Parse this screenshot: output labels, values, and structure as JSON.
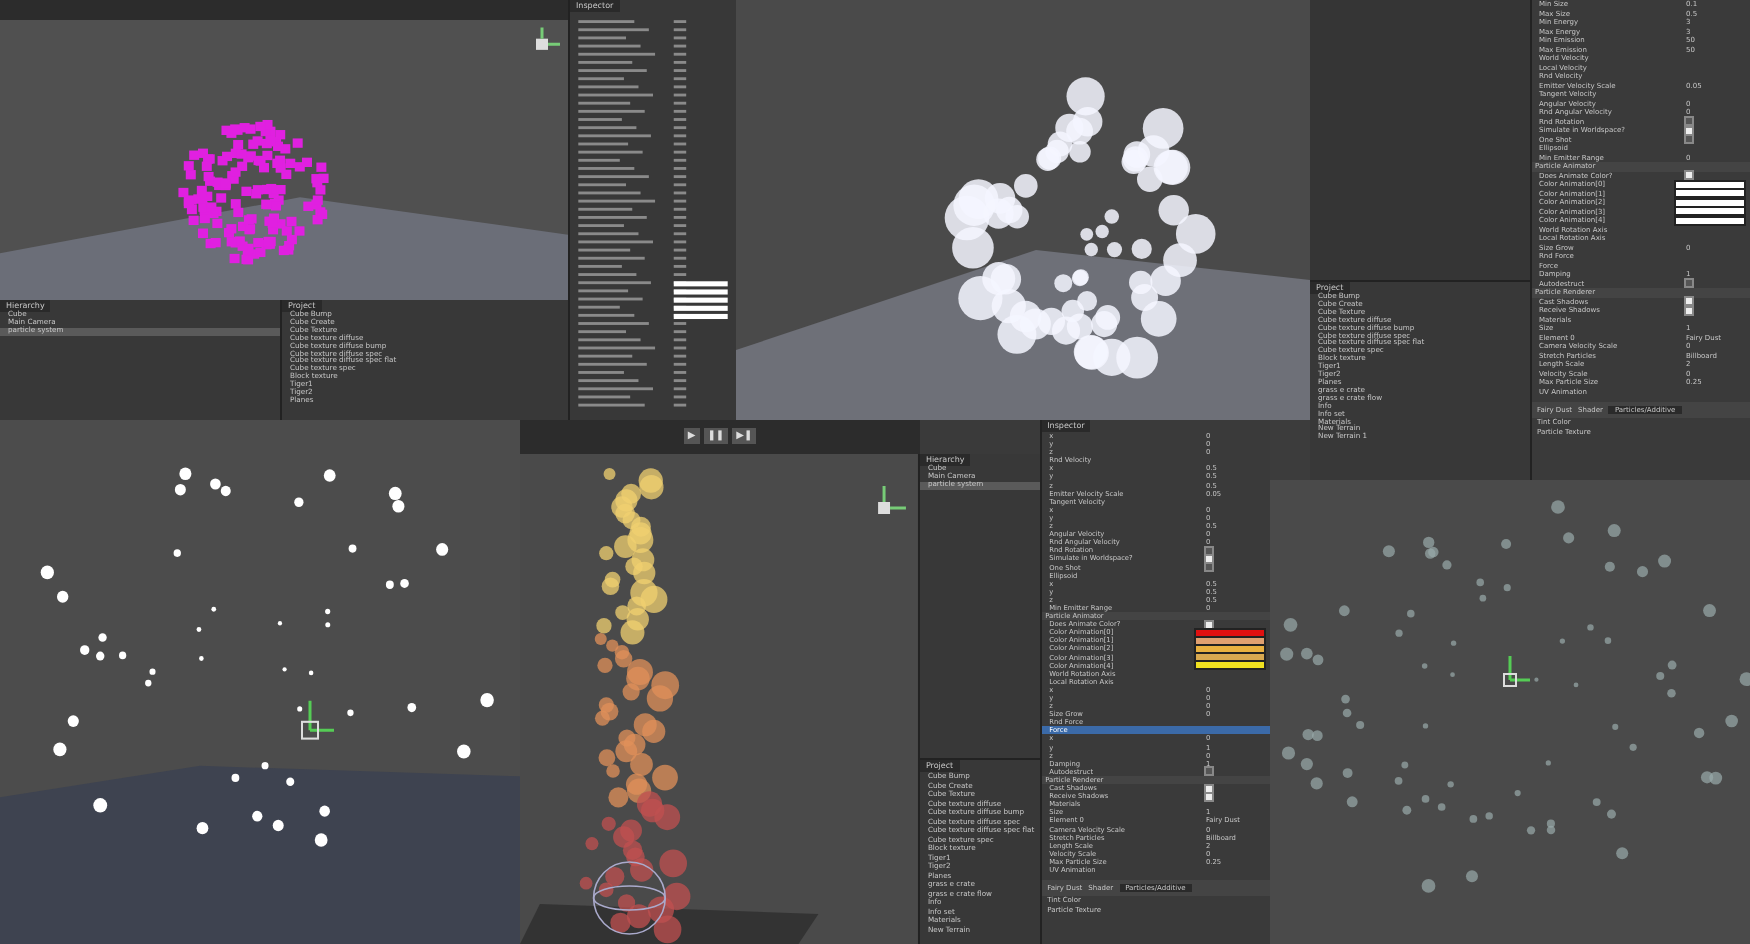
{
  "editor_a": {
    "hierarchy": {
      "title": "Hierarchy",
      "items": [
        {
          "label": "Cube",
          "selected": false
        },
        {
          "label": "Main Camera",
          "selected": false
        },
        {
          "label": "particle system",
          "selected": true
        }
      ]
    },
    "project": {
      "title": "Project",
      "items": [
        "Cube Bump",
        "Cube Create",
        "Cube Texture",
        "Cube texture diffuse",
        "Cube texture diffuse bump",
        "Cube texture diffuse spec",
        "Cube texture diffuse spec flat",
        "Cube texture spec",
        "Block texture",
        "Tiger1",
        "Tiger2",
        "Planes"
      ]
    },
    "inspector": {
      "title": "Inspector"
    }
  },
  "editor_c": {
    "project": {
      "title": "Project",
      "items": [
        "Cube Bump",
        "Cube Create",
        "Cube Texture",
        "Cube texture diffuse",
        "Cube texture diffuse bump",
        "Cube texture diffuse spec",
        "Cube texture diffuse spec flat",
        "Cube texture spec",
        "Block texture",
        "Tiger1",
        "Tiger2",
        "Planes",
        "grass e crate",
        "grass e crate flow",
        "Info",
        "Info set",
        "Materials",
        "New Terrain",
        "New Terrain 1"
      ]
    },
    "properties": [
      {
        "kind": "field",
        "label": "Min Size",
        "value": "0.1"
      },
      {
        "kind": "field",
        "label": "Max Size",
        "value": "0.5"
      },
      {
        "kind": "field",
        "label": "Min Energy",
        "value": "3"
      },
      {
        "kind": "field",
        "label": "Max Energy",
        "value": "3"
      },
      {
        "kind": "field",
        "label": "Min Emission",
        "value": "50"
      },
      {
        "kind": "field",
        "label": "Max Emission",
        "value": "50"
      },
      {
        "kind": "group",
        "label": "World Velocity"
      },
      {
        "kind": "group",
        "label": "Local Velocity"
      },
      {
        "kind": "group",
        "label": "Rnd Velocity"
      },
      {
        "kind": "field",
        "label": "Emitter Velocity Scale",
        "value": "0.05"
      },
      {
        "kind": "group",
        "label": "Tangent Velocity"
      },
      {
        "kind": "field",
        "label": "Angular Velocity",
        "value": "0"
      },
      {
        "kind": "field",
        "label": "Rnd Angular Velocity",
        "value": "0"
      },
      {
        "kind": "check",
        "label": "Rnd Rotation",
        "checked": false
      },
      {
        "kind": "check",
        "label": "Simulate in Worldspace?",
        "checked": true
      },
      {
        "kind": "check",
        "label": "One Shot",
        "checked": false
      },
      {
        "kind": "group",
        "label": "Ellipsoid"
      },
      {
        "kind": "field",
        "label": "Min Emitter Range",
        "value": "0"
      },
      {
        "kind": "header",
        "label": "Particle Animator"
      },
      {
        "kind": "check",
        "label": "Does Animate Color?",
        "checked": true
      },
      {
        "kind": "color",
        "label": "Color Animation[0]",
        "color": "#ffffff"
      },
      {
        "kind": "color",
        "label": "Color Animation[1]",
        "color": "#ffffff"
      },
      {
        "kind": "color",
        "label": "Color Animation[2]",
        "color": "#ffffff"
      },
      {
        "kind": "color",
        "label": "Color Animation[3]",
        "color": "#ffffff"
      },
      {
        "kind": "color",
        "label": "Color Animation[4]",
        "color": "#ffffff"
      },
      {
        "kind": "group",
        "label": "World Rotation Axis"
      },
      {
        "kind": "group",
        "label": "Local Rotation Axis"
      },
      {
        "kind": "field",
        "label": "Size Grow",
        "value": "0"
      },
      {
        "kind": "group",
        "label": "Rnd Force"
      },
      {
        "kind": "group",
        "label": "Force"
      },
      {
        "kind": "field",
        "label": "Damping",
        "value": "1"
      },
      {
        "kind": "check",
        "label": "Autodestruct",
        "checked": false
      },
      {
        "kind": "header",
        "label": "Particle Renderer"
      },
      {
        "kind": "check",
        "label": "Cast Shadows",
        "checked": true
      },
      {
        "kind": "check",
        "label": "Receive Shadows",
        "checked": true
      },
      {
        "kind": "group",
        "label": "Materials"
      },
      {
        "kind": "field",
        "label": "Size",
        "value": "1"
      },
      {
        "kind": "field",
        "label": "Element 0",
        "value": "Fairy Dust"
      },
      {
        "kind": "field",
        "label": "Camera Velocity Scale",
        "value": "0"
      },
      {
        "kind": "field",
        "label": "Stretch Particles",
        "value": "Billboard"
      },
      {
        "kind": "field",
        "label": "Length Scale",
        "value": "2"
      },
      {
        "kind": "field",
        "label": "Velocity Scale",
        "value": "0"
      },
      {
        "kind": "field",
        "label": "Max Particle Size",
        "value": "0.25"
      },
      {
        "kind": "group",
        "label": "UV Animation"
      }
    ],
    "material": {
      "name": "Fairy Dust",
      "shader_label": "Shader",
      "shader": "Particles/Additive",
      "slots": [
        "Tint Color",
        "Particle Texture"
      ]
    }
  },
  "editor_e": {
    "toolbar": {
      "play": "▶",
      "pause": "❚❚",
      "step": "▶❚"
    },
    "hierarchy": {
      "title": "Hierarchy",
      "items": [
        {
          "label": "Cube",
          "selected": false
        },
        {
          "label": "Main Camera",
          "selected": false
        },
        {
          "label": "particle system",
          "selected": true
        }
      ]
    },
    "project": {
      "title": "Project",
      "items": [
        "Cube Bump",
        "Cube Create",
        "Cube Texture",
        "Cube texture diffuse",
        "Cube texture diffuse bump",
        "Cube texture diffuse spec",
        "Cube texture diffuse spec flat",
        "Cube texture spec",
        "Block texture",
        "Tiger1",
        "Tiger2",
        "Planes",
        "grass e crate",
        "grass e crate flow",
        "Info",
        "Info set",
        "Materials",
        "New Terrain"
      ]
    },
    "inspector": {
      "title": "Inspector"
    },
    "properties": [
      {
        "kind": "field",
        "label": "x",
        "value": "0",
        "selected": false
      },
      {
        "kind": "field",
        "label": "y",
        "value": "0",
        "selected": false
      },
      {
        "kind": "field",
        "label": "z",
        "value": "0",
        "selected": false
      },
      {
        "kind": "group",
        "label": "Rnd Velocity",
        "selected": false
      },
      {
        "kind": "field",
        "label": "x",
        "value": "0.5",
        "selected": false
      },
      {
        "kind": "field",
        "label": "y",
        "value": "0.5",
        "selected": false
      },
      {
        "kind": "field",
        "label": "z",
        "value": "0.5",
        "selected": false
      },
      {
        "kind": "field",
        "label": "Emitter Velocity Scale",
        "value": "0.05",
        "selected": false
      },
      {
        "kind": "group",
        "label": "Tangent Velocity",
        "selected": false
      },
      {
        "kind": "field",
        "label": "x",
        "value": "0",
        "selected": false
      },
      {
        "kind": "field",
        "label": "y",
        "value": "0",
        "selected": false
      },
      {
        "kind": "field",
        "label": "z",
        "value": "0.5",
        "selected": false
      },
      {
        "kind": "field",
        "label": "Angular Velocity",
        "value": "0",
        "selected": false
      },
      {
        "kind": "field",
        "label": "Rnd Angular Velocity",
        "value": "0",
        "selected": false
      },
      {
        "kind": "check",
        "label": "Rnd Rotation",
        "checked": false,
        "selected": false
      },
      {
        "kind": "check",
        "label": "Simulate in Worldspace?",
        "checked": true,
        "selected": false
      },
      {
        "kind": "check",
        "label": "One Shot",
        "checked": false,
        "selected": false
      },
      {
        "kind": "group",
        "label": "Ellipsoid",
        "selected": false
      },
      {
        "kind": "field",
        "label": "x",
        "value": "0.5",
        "selected": false
      },
      {
        "kind": "field",
        "label": "y",
        "value": "0.5",
        "selected": false
      },
      {
        "kind": "field",
        "label": "z",
        "value": "0.5",
        "selected": false
      },
      {
        "kind": "field",
        "label": "Min Emitter Range",
        "value": "0",
        "selected": false
      },
      {
        "kind": "header",
        "label": "Particle Animator",
        "selected": false
      },
      {
        "kind": "check",
        "label": "Does Animate Color?",
        "checked": true,
        "selected": false
      },
      {
        "kind": "color",
        "label": "Color Animation[0]",
        "color": "#e01010",
        "selected": false
      },
      {
        "kind": "color",
        "label": "Color Animation[1]",
        "color": "#e0a070",
        "selected": false
      },
      {
        "kind": "color",
        "label": "Color Animation[2]",
        "color": "#e8b040",
        "selected": false
      },
      {
        "kind": "color",
        "label": "Color Animation[3]",
        "color": "#d8a850",
        "selected": false
      },
      {
        "kind": "color",
        "label": "Color Animation[4]",
        "color": "#f0e020",
        "selected": false
      },
      {
        "kind": "group",
        "label": "World Rotation Axis",
        "selected": false
      },
      {
        "kind": "group",
        "label": "Local Rotation Axis",
        "selected": false
      },
      {
        "kind": "field",
        "label": "x",
        "value": "0",
        "selected": false
      },
      {
        "kind": "field",
        "label": "y",
        "value": "0",
        "selected": false
      },
      {
        "kind": "field",
        "label": "z",
        "value": "0",
        "selected": false
      },
      {
        "kind": "field",
        "label": "Size Grow",
        "value": "0",
        "selected": false
      },
      {
        "kind": "group",
        "label": "Rnd Force",
        "selected": false
      },
      {
        "kind": "group",
        "label": "Force",
        "selected": true
      },
      {
        "kind": "field",
        "label": "x",
        "value": "0",
        "selected": false
      },
      {
        "kind": "field",
        "label": "y",
        "value": "1",
        "selected": false
      },
      {
        "kind": "field",
        "label": "z",
        "value": "0",
        "selected": false
      },
      {
        "kind": "field",
        "label": "Damping",
        "value": "1",
        "selected": false
      },
      {
        "kind": "check",
        "label": "Autodestruct",
        "checked": false,
        "selected": false
      },
      {
        "kind": "header",
        "label": "Particle Renderer",
        "selected": false
      },
      {
        "kind": "check",
        "label": "Cast Shadows",
        "checked": true,
        "selected": false
      },
      {
        "kind": "check",
        "label": "Receive Shadows",
        "checked": true,
        "selected": false
      },
      {
        "kind": "group",
        "label": "Materials",
        "selected": false
      },
      {
        "kind": "field",
        "label": "Size",
        "value": "1",
        "selected": false
      },
      {
        "kind": "field",
        "label": "Element 0",
        "value": "Fairy Dust",
        "selected": false
      },
      {
        "kind": "field",
        "label": "Camera Velocity Scale",
        "value": "0",
        "selected": false
      },
      {
        "kind": "field",
        "label": "Stretch Particles",
        "value": "Billboard",
        "selected": false
      },
      {
        "kind": "field",
        "label": "Length Scale",
        "value": "2",
        "selected": false
      },
      {
        "kind": "field",
        "label": "Velocity Scale",
        "value": "0",
        "selected": false
      },
      {
        "kind": "field",
        "label": "Max Particle Size",
        "value": "0.25",
        "selected": false
      },
      {
        "kind": "group",
        "label": "UV Animation",
        "selected": false
      }
    ],
    "material": {
      "name": "Fairy Dust",
      "shader_label": "Shader",
      "shader": "Particles/Additive",
      "slots": [
        "Tint Color",
        "Particle Texture"
      ]
    }
  }
}
